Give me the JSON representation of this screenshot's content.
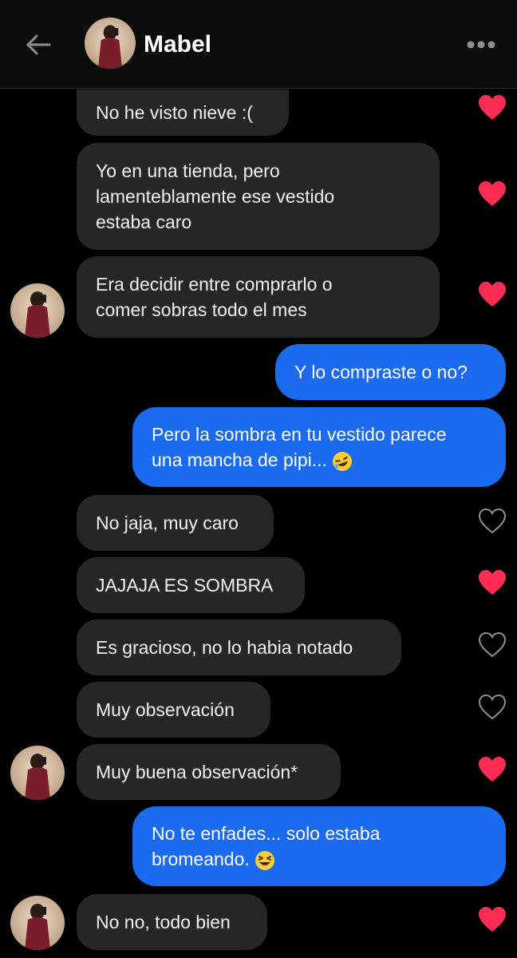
{
  "header": {
    "contact_name": "Mabel",
    "back_icon": "arrow-left-icon",
    "more_icon": "more-dots-icon"
  },
  "colors": {
    "background": "#000000",
    "incoming_bubble": "#262628",
    "outgoing_bubble": "#1a6bf0",
    "heart_liked": "#ff2d55",
    "heart_outline": "#8e8e93"
  },
  "messages": [
    {
      "from": "them",
      "text": "No he visto nieve :(",
      "liked": true
    },
    {
      "from": "them",
      "text": "Yo en una tienda, pero\nlamenteblamente ese vestido\nestaba caro",
      "liked": true
    },
    {
      "from": "them",
      "text": "Era decidir entre comprarlo o\ncomer sobras todo el mes",
      "liked": true
    },
    {
      "from": "me",
      "text": "Y lo compraste o no?"
    },
    {
      "from": "me",
      "text": "Pero la sombra en tu vestido parece\nuna mancha de pipi...",
      "emoji": "rofl-emoji"
    },
    {
      "from": "them",
      "text": "No jaja, muy caro",
      "liked": false
    },
    {
      "from": "them",
      "text": "JAJAJA ES SOMBRA",
      "liked": true
    },
    {
      "from": "them",
      "text": "Es gracioso, no lo habia notado",
      "liked": false
    },
    {
      "from": "them",
      "text": "Muy observación",
      "liked": false
    },
    {
      "from": "them",
      "text": "Muy buena observación*",
      "liked": true
    },
    {
      "from": "me",
      "text": "No te enfades... solo estaba\nbromeando.",
      "emoji": "grinning-squinting-emoji"
    },
    {
      "from": "them",
      "text": "No no, todo bien",
      "liked": true
    }
  ]
}
